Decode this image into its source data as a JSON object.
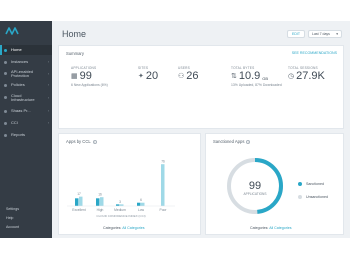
{
  "sidebar": {
    "items": [
      {
        "label": "Home",
        "active": true
      },
      {
        "label": "Instances",
        "chevron": true
      },
      {
        "label": "API-enabled\nProtection",
        "chevron": true
      },
      {
        "label": "Policies",
        "chevron": true
      },
      {
        "label": "Cloud\nInfrastructure",
        "chevron": true
      },
      {
        "label": "Shaas Pr...",
        "chevron": true
      },
      {
        "label": "CCI",
        "chevron": true
      },
      {
        "label": "Reports",
        "chevron": false
      }
    ],
    "bottom": [
      "Settings",
      "Help",
      "Account"
    ]
  },
  "header": {
    "title": "Home",
    "edit_label": "EDIT",
    "range_label": "Last 7 days"
  },
  "summary": {
    "title": "Summary",
    "link": "SEE RECOMMENDATIONS",
    "metrics": [
      {
        "label": "APPLICATIONS",
        "icon": "applications-icon",
        "value": "99",
        "unit": "",
        "sub": "6 New Applications (6%)"
      },
      {
        "label": "SITES",
        "icon": "sites-icon",
        "value": "20",
        "unit": "",
        "sub": ""
      },
      {
        "label": "USERS",
        "icon": "users-icon",
        "value": "26",
        "unit": "",
        "sub": ""
      },
      {
        "label": "TOTAL BYTES",
        "icon": "bytes-icon",
        "value": "10.9",
        "unit": "GB",
        "sub": "13% Uploaded, 87% Downloaded"
      },
      {
        "label": "TOTAL SESSIONS",
        "icon": "sessions-icon",
        "value": "27.9K",
        "unit": "",
        "sub": ""
      }
    ]
  },
  "apps_by_cci": {
    "title": "Apps by CCL",
    "xlabel": "CLOUD CONFIDENCE INDEX (CCI)",
    "footer_prefix": "Categories: ",
    "footer_value": "All Categories"
  },
  "sanctioned": {
    "title": "Sanctioned Apps",
    "center_value": "99",
    "center_label": "APPLICATIONS",
    "legend": [
      {
        "label": "Sanctioned",
        "value": "48",
        "color": "#2aa7c7"
      },
      {
        "label": "Unsanctioned",
        "value": "51",
        "color": "#d7dde2"
      }
    ],
    "footer_prefix": "Categories: ",
    "footer_value": "All Categories"
  },
  "colors": {
    "accent": "#2aa7c7",
    "sidebar": "#343c45"
  },
  "chart_data": {
    "type": "bar",
    "categories": [
      "Excellent",
      "High",
      "Medium",
      "Low",
      "Poor"
    ],
    "series": [
      {
        "values": [
          14,
          14,
          3,
          6,
          76
        ]
      },
      {
        "values": [
          17,
          16,
          3,
          6,
          0
        ]
      }
    ],
    "value_labels": [
      "17",
      "16",
      "3",
      "6",
      "76"
    ],
    "xlabel": "CLOUD CONFIDENCE INDEX (CCI)",
    "ylim": [
      0,
      80
    ],
    "grid": false
  }
}
